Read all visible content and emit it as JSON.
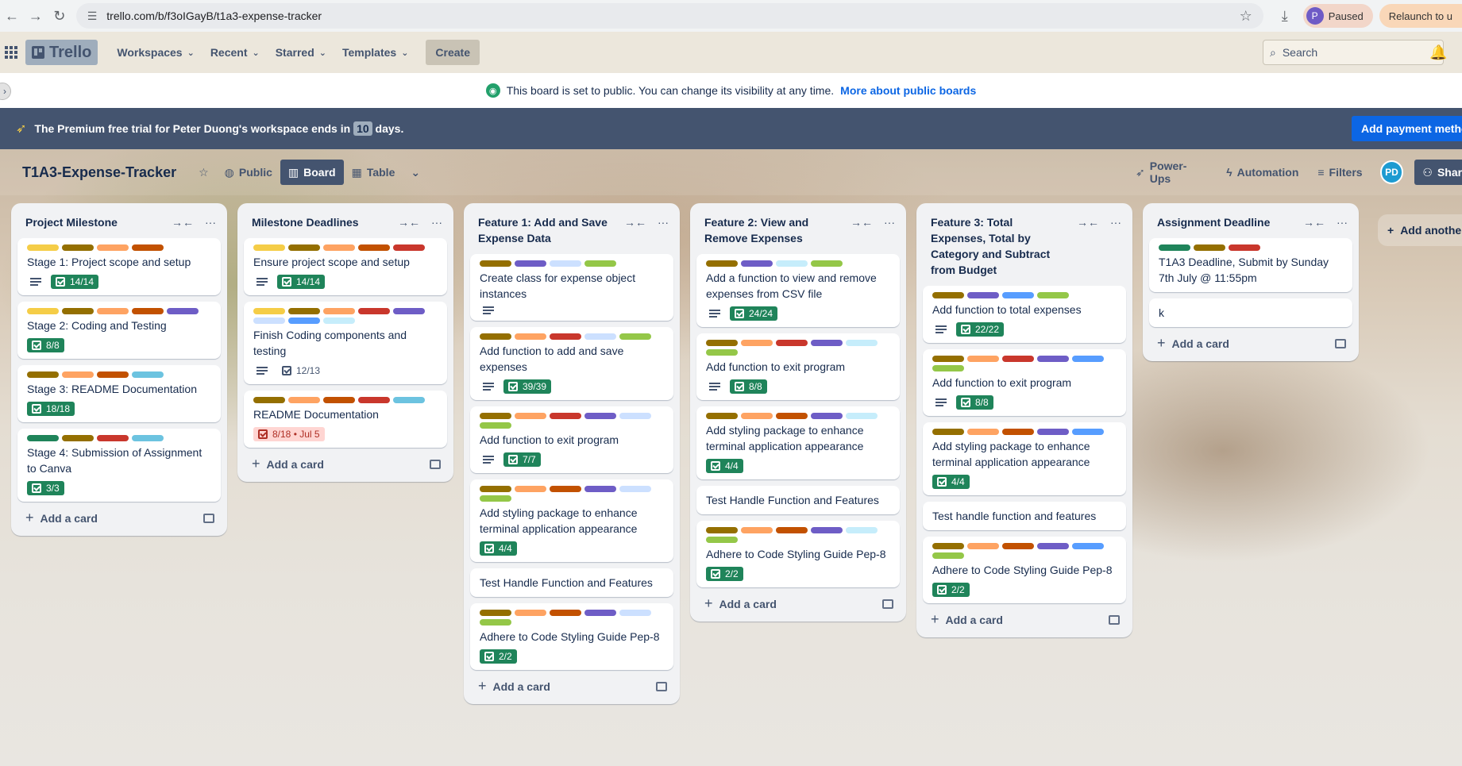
{
  "browser": {
    "url": "trello.com/b/f3oIGayB/t1a3-expense-tracker",
    "profile_initial": "P",
    "paused_label": "Paused",
    "relaunch_label": "Relaunch to u"
  },
  "header": {
    "logo_text": "Trello",
    "menus": [
      "Workspaces",
      "Recent",
      "Starred",
      "Templates"
    ],
    "create_label": "Create",
    "search_placeholder": "Search"
  },
  "notice": {
    "text": "This board is set to public. You can change its visibility at any time.",
    "link": "More about public boards"
  },
  "premium": {
    "text_before": "The Premium free trial for Peter Duong's workspace ends in",
    "days": "10",
    "text_after": "days.",
    "button": "Add payment metho"
  },
  "board": {
    "title": "T1A3-Expense-Tracker",
    "visibility": "Public",
    "view_board": "Board",
    "view_table": "Table",
    "powerups": "Power-Ups",
    "automation": "Automation",
    "filters": "Filters",
    "member_initials": "PD",
    "share": "Share"
  },
  "add_card_label": "Add a card",
  "add_another_label": "Add another l",
  "colors": {
    "yellow": "#f5cd47",
    "olive": "#946f00",
    "orange": "#fea362",
    "darkorange": "#c25100",
    "purple": "#6e5dc6",
    "red": "#c9372c",
    "sky": "#6cc3e0",
    "green": "#1f845a",
    "lightblue": "#cce0ff",
    "lime": "#94c748",
    "blue": "#579dff",
    "lightsky": "#c6edfb"
  },
  "lists": [
    {
      "title": "Project Milestone",
      "cards": [
        {
          "title": "Stage 1: Project scope and setup",
          "labels": [
            "yellow",
            "olive",
            "orange",
            "darkorange"
          ],
          "desc": true,
          "check": "14/14",
          "status": "done"
        },
        {
          "title": "Stage 2: Coding and Testing",
          "labels": [
            "yellow",
            "olive",
            "orange",
            "darkorange",
            "purple"
          ],
          "desc": false,
          "check": "8/8",
          "status": "done"
        },
        {
          "title": "Stage 3: README Documentation",
          "labels": [
            "olive",
            "orange",
            "darkorange",
            "sky"
          ],
          "desc": false,
          "check": "18/18",
          "status": "done"
        },
        {
          "title": "Stage 4: Submission of Assignment to Canva",
          "labels": [
            "green",
            "olive",
            "red",
            "sky"
          ],
          "desc": false,
          "check": "3/3",
          "status": "done"
        }
      ]
    },
    {
      "title": "Milestone Deadlines",
      "cards": [
        {
          "title": "Ensure project scope and setup",
          "labels": [
            "yellow",
            "olive",
            "orange",
            "darkorange",
            "red"
          ],
          "desc": true,
          "check": "14/14",
          "status": "done"
        },
        {
          "title": "Finish Coding components and testing",
          "labels": [
            "yellow",
            "olive",
            "orange",
            "red",
            "purple",
            "lightblue",
            "blue",
            "lightsky"
          ],
          "desc": true,
          "check": "12/13",
          "status": "open"
        },
        {
          "title": "README Documentation",
          "labels": [
            "olive",
            "orange",
            "darkorange",
            "red",
            "sky"
          ],
          "desc": false,
          "check": "8/18 • Jul 5",
          "status": "overdue"
        }
      ]
    },
    {
      "title": "Feature 1: Add and Save Expense Data",
      "cards": [
        {
          "title": "Create class for expense object instances",
          "labels": [
            "olive",
            "purple",
            "lightblue",
            "lime"
          ],
          "desc": true,
          "check": "",
          "status": "none"
        },
        {
          "title": "Add function to add and save expenses",
          "labels": [
            "olive",
            "orange",
            "red",
            "lightblue",
            "lime"
          ],
          "desc": true,
          "check": "39/39",
          "status": "done"
        },
        {
          "title": "Add function to exit program",
          "labels": [
            "olive",
            "orange",
            "red",
            "purple",
            "lightblue",
            "lime"
          ],
          "desc": true,
          "check": "7/7",
          "status": "done"
        },
        {
          "title": "Add styling package to enhance terminal application appearance",
          "labels": [
            "olive",
            "orange",
            "darkorange",
            "purple",
            "lightblue",
            "lime"
          ],
          "desc": false,
          "check": "4/4",
          "status": "done"
        },
        {
          "title": "Test Handle Function and Features",
          "labels": [],
          "desc": false,
          "check": "",
          "status": "none"
        },
        {
          "title": "Adhere to Code Styling Guide Pep-8",
          "labels": [
            "olive",
            "orange",
            "darkorange",
            "purple",
            "lightblue",
            "lime"
          ],
          "desc": false,
          "check": "2/2",
          "status": "done"
        }
      ]
    },
    {
      "title": "Feature 2: View and Remove Expenses",
      "cards": [
        {
          "title": "Add a function to view and remove expenses from CSV file",
          "labels": [
            "olive",
            "purple",
            "lightsky",
            "lime"
          ],
          "desc": true,
          "check": "24/24",
          "status": "done"
        },
        {
          "title": "Add function to exit program",
          "labels": [
            "olive",
            "orange",
            "red",
            "purple",
            "lightsky",
            "lime"
          ],
          "desc": true,
          "check": "8/8",
          "status": "done"
        },
        {
          "title": "Add styling package to enhance terminal application appearance",
          "labels": [
            "olive",
            "orange",
            "darkorange",
            "purple",
            "lightsky"
          ],
          "desc": false,
          "check": "4/4",
          "status": "done"
        },
        {
          "title": "Test Handle Function and Features",
          "labels": [],
          "desc": false,
          "check": "",
          "status": "none"
        },
        {
          "title": "Adhere to Code Styling Guide Pep-8",
          "labels": [
            "olive",
            "orange",
            "darkorange",
            "purple",
            "lightsky",
            "lime"
          ],
          "desc": false,
          "check": "2/2",
          "status": "done"
        }
      ]
    },
    {
      "title": "Feature 3: Total Expenses, Total by Category and Subtract from Budget",
      "cards": [
        {
          "title": "Add function to total expenses",
          "labels": [
            "olive",
            "purple",
            "blue",
            "lime"
          ],
          "desc": true,
          "check": "22/22",
          "status": "done"
        },
        {
          "title": "Add function to exit program",
          "labels": [
            "olive",
            "orange",
            "red",
            "purple",
            "blue",
            "lime"
          ],
          "desc": true,
          "check": "8/8",
          "status": "done"
        },
        {
          "title": "Add styling package to enhance terminal application appearance",
          "labels": [
            "olive",
            "orange",
            "darkorange",
            "purple",
            "blue"
          ],
          "desc": false,
          "check": "4/4",
          "status": "done"
        },
        {
          "title": "Test handle function and features",
          "labels": [],
          "desc": false,
          "check": "",
          "status": "none"
        },
        {
          "title": "Adhere to Code Styling Guide Pep-8",
          "labels": [
            "olive",
            "orange",
            "darkorange",
            "purple",
            "blue",
            "lime"
          ],
          "desc": false,
          "check": "2/2",
          "status": "done"
        }
      ]
    },
    {
      "title": "Assignment Deadline",
      "cards": [
        {
          "title": "T1A3 Deadline, Submit by Sunday 7th July @ 11:55pm",
          "labels": [
            "green",
            "olive",
            "red"
          ],
          "desc": false,
          "check": "",
          "status": "none"
        },
        {
          "title": "k",
          "labels": [],
          "desc": false,
          "check": "",
          "status": "none"
        }
      ]
    }
  ]
}
